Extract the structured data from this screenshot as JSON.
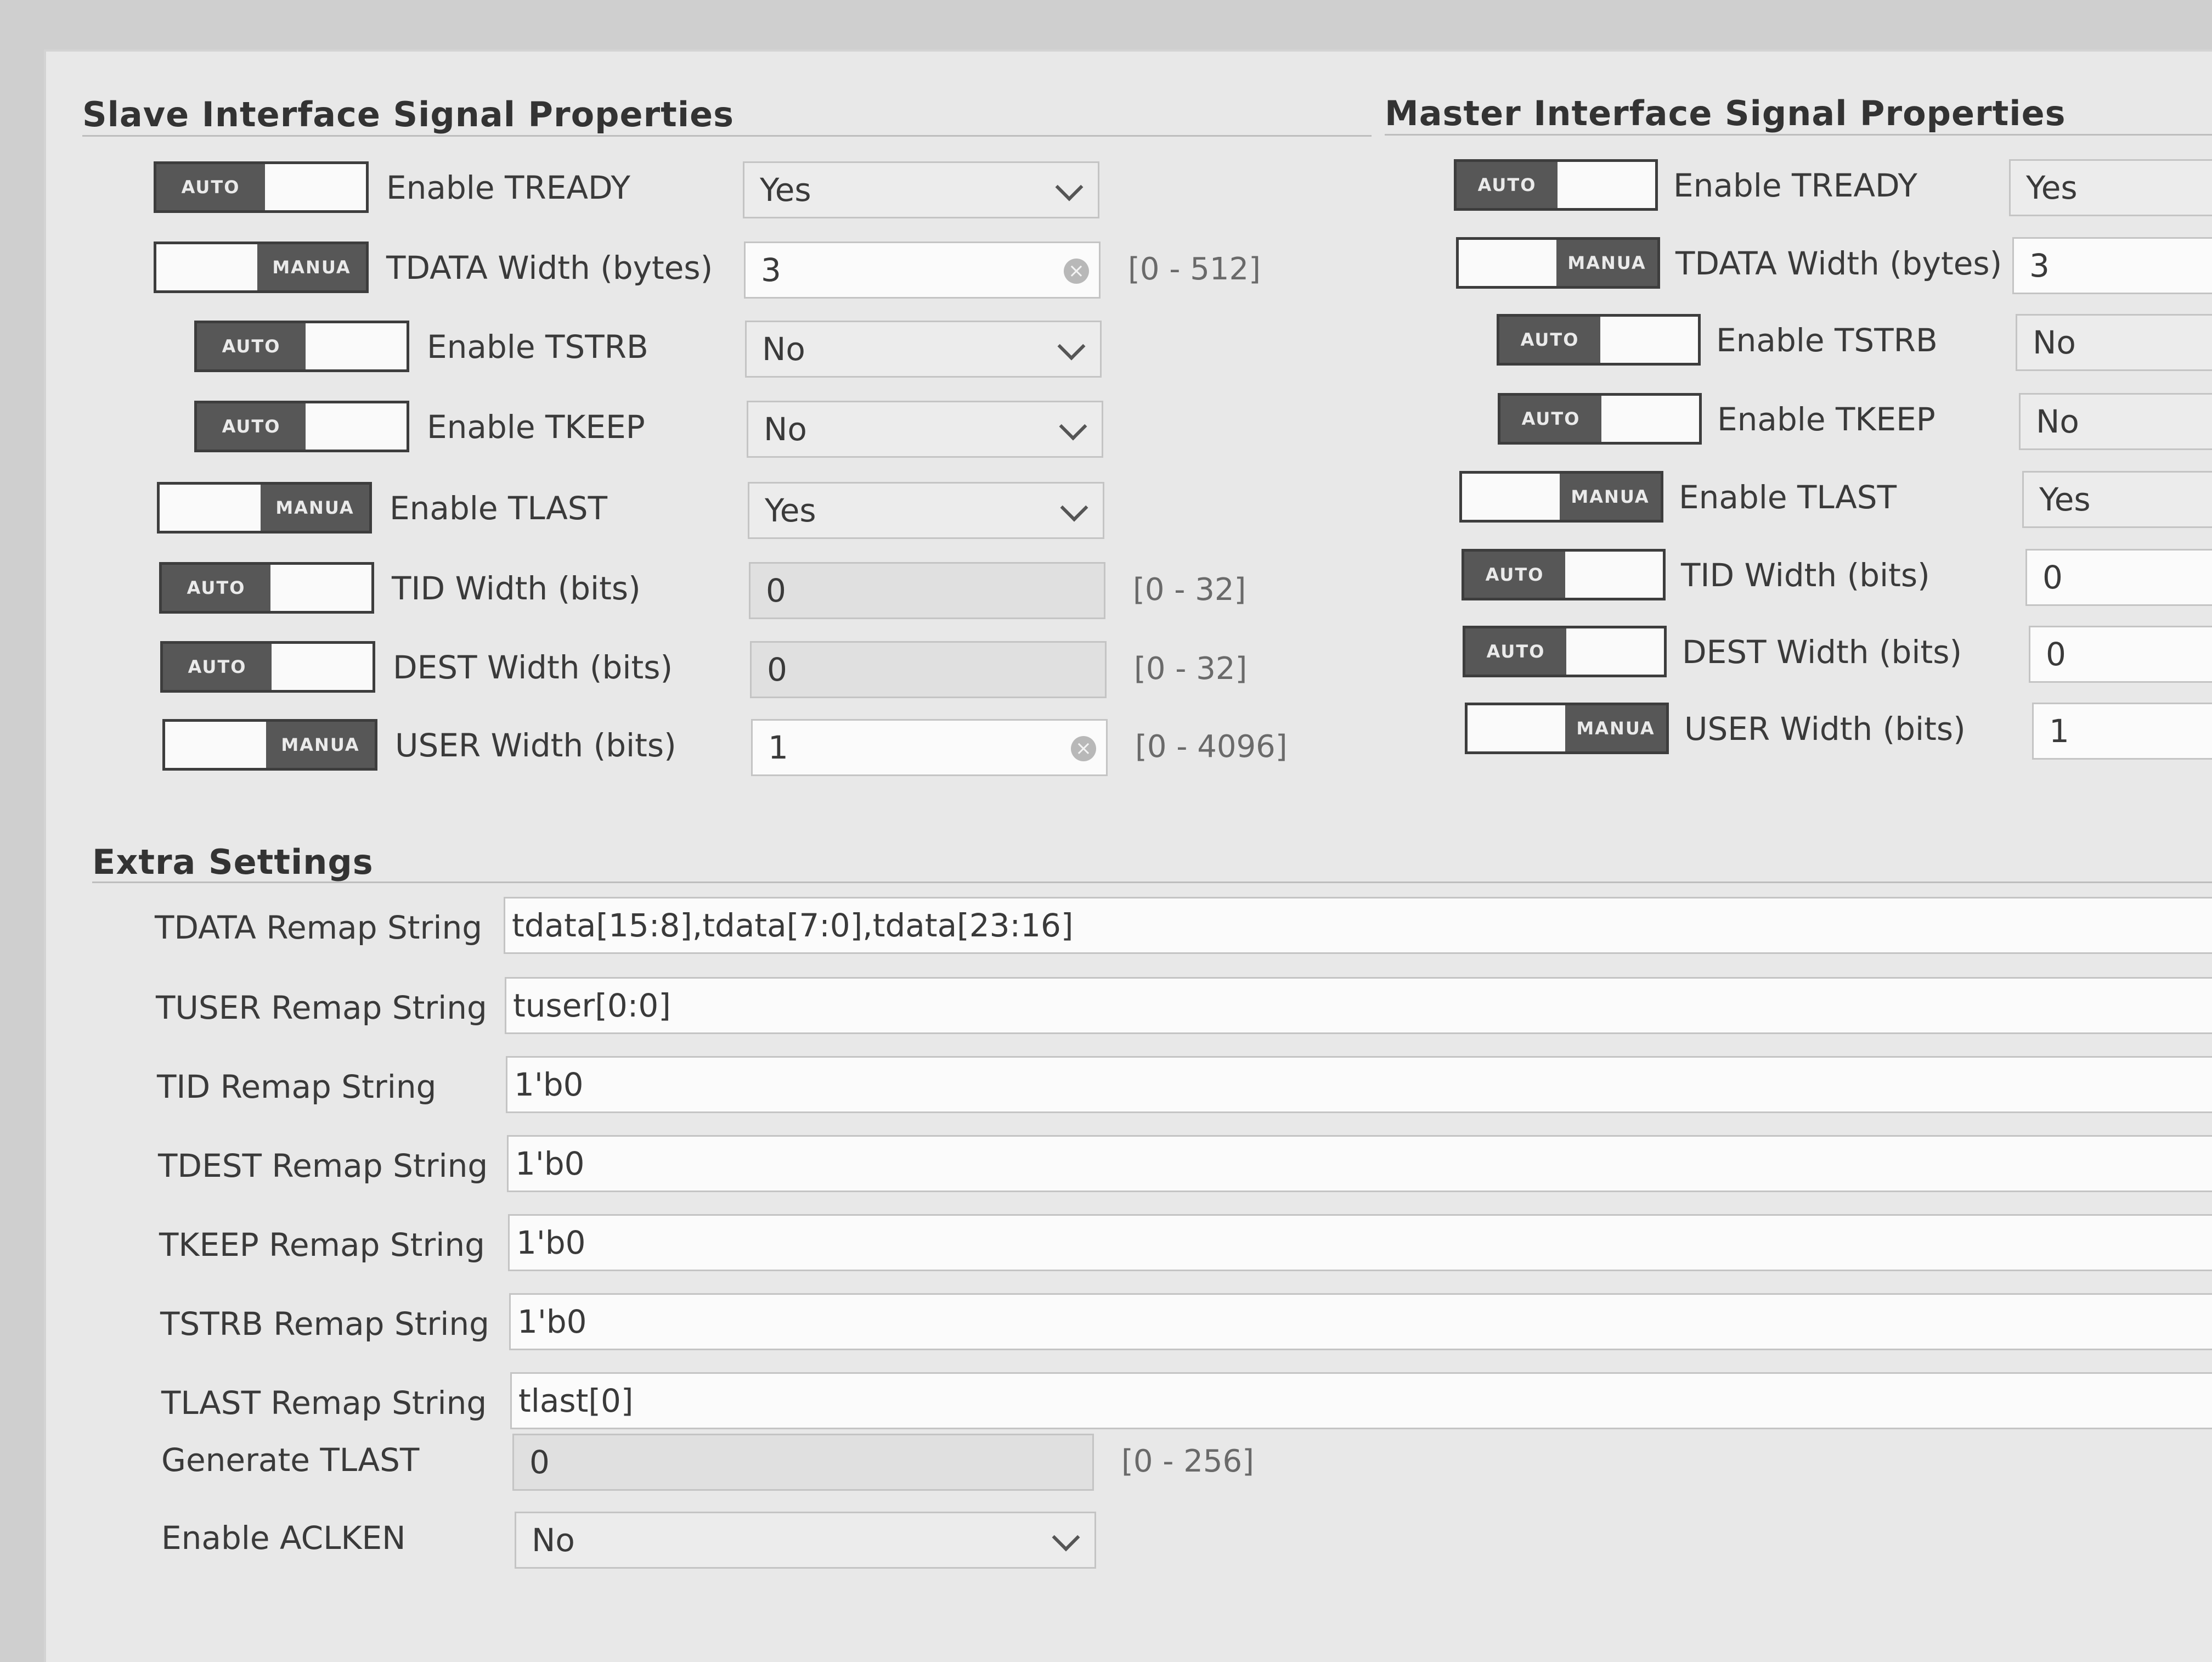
{
  "slave": {
    "title": "Slave Interface Signal Properties",
    "rows": [
      {
        "mode": "AUTO",
        "label": "Enable TREADY",
        "value": "Yes",
        "kind": "select",
        "range": ""
      },
      {
        "mode": "MANUA",
        "label": "TDATA Width (bytes)",
        "value": "3",
        "kind": "input-clear",
        "range": "[0 - 512]"
      },
      {
        "mode": "AUTO",
        "label": "Enable TSTRB",
        "value": "No",
        "kind": "select",
        "range": ""
      },
      {
        "mode": "AUTO",
        "label": "Enable TKEEP",
        "value": "No",
        "kind": "select",
        "range": ""
      },
      {
        "mode": "MANUA",
        "label": "Enable TLAST",
        "value": "Yes",
        "kind": "select",
        "range": ""
      },
      {
        "mode": "AUTO",
        "label": "TID Width (bits)",
        "value": "0",
        "kind": "input-readonly",
        "range": "[0 - 32]"
      },
      {
        "mode": "AUTO",
        "label": "DEST Width (bits)",
        "value": "0",
        "kind": "input-readonly",
        "range": "[0 - 32]"
      },
      {
        "mode": "MANUA",
        "label": "USER Width (bits)",
        "value": "1",
        "kind": "input-clear",
        "range": "[0 - 4096]"
      }
    ]
  },
  "master": {
    "title": "Master Interface Signal Properties",
    "rows": [
      {
        "mode": "AUTO",
        "label": "Enable TREADY",
        "value": "Yes"
      },
      {
        "mode": "MANUA",
        "label": "TDATA Width (bytes)",
        "value": "3"
      },
      {
        "mode": "AUTO",
        "label": "Enable TSTRB",
        "value": "No"
      },
      {
        "mode": "AUTO",
        "label": "Enable TKEEP",
        "value": "No"
      },
      {
        "mode": "MANUA",
        "label": "Enable TLAST",
        "value": "Yes"
      },
      {
        "mode": "AUTO",
        "label": "TID Width (bits)",
        "value": "0"
      },
      {
        "mode": "AUTO",
        "label": "DEST Width (bits)",
        "value": "0"
      },
      {
        "mode": "MANUA",
        "label": "USER Width (bits)",
        "value": "1"
      }
    ]
  },
  "extra": {
    "title": "Extra Settings",
    "rows": [
      {
        "label": "TDATA Remap String",
        "value": "tdata[15:8],tdata[7:0],tdata[23:16]"
      },
      {
        "label": "TUSER Remap String",
        "value": "tuser[0:0]"
      },
      {
        "label": "TID Remap String",
        "value": "1'b0"
      },
      {
        "label": "TDEST Remap String",
        "value": "1'b0"
      },
      {
        "label": "TKEEP Remap String",
        "value": "1'b0"
      },
      {
        "label": "TSTRB Remap String",
        "value": "1'b0"
      },
      {
        "label": "TLAST Remap String",
        "value": "tlast[0]"
      }
    ],
    "generate_tlast": {
      "label": "Generate TLAST",
      "value": "0",
      "range": "[0 - 256]"
    },
    "enable_aclken": {
      "label": "Enable ACLKEN",
      "value": "No"
    }
  },
  "colors": {
    "panel": "#e8e8e8",
    "toggle_knob": "#575757",
    "field_border": "#c4c4c4"
  }
}
